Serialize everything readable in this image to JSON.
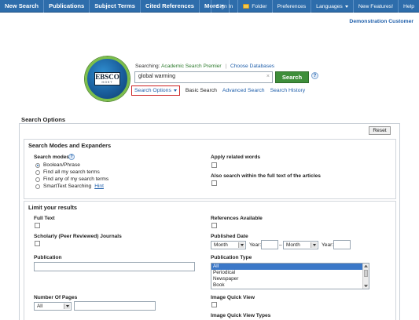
{
  "nav": {
    "left": [
      "New Search",
      "Publications",
      "Subject Terms",
      "Cited References",
      "More"
    ],
    "right": {
      "sign_in": "Sign In",
      "folder": "Folder",
      "preferences": "Preferences",
      "languages": "Languages",
      "new_features": "New Features!",
      "help": "Help"
    }
  },
  "account": {
    "customer": "Demonstration Customer"
  },
  "logo": {
    "main": "EBSCO",
    "sub": "HOST"
  },
  "search": {
    "searching_label": "Searching:",
    "database": "Academic Search Premier",
    "choose_databases": "Choose Databases",
    "query": "global warming",
    "clear": "×",
    "button": "Search",
    "help": "?"
  },
  "sub_options": {
    "search_options": "Search Options",
    "basic": "Basic Search",
    "advanced": "Advanced Search",
    "history": "Search History"
  },
  "options_panel": {
    "title": "Search Options",
    "reset": "Reset",
    "modes": {
      "title": "Search Modes and Expanders",
      "search_modes_label": "Search modes",
      "help": "?",
      "options": [
        "Boolean/Phrase",
        "Find all my search terms",
        "Find any of my search terms",
        "SmartText Searching"
      ],
      "selected_index": 0,
      "hint": "Hint",
      "apply_related": "Apply related words",
      "also_fulltext": "Also search within the full text of the articles"
    },
    "limits": {
      "title": "Limit your results",
      "full_text": "Full Text",
      "references": "References Available",
      "scholarly": "Scholarly (Peer Reviewed) Journals",
      "published_date": "Published Date",
      "month_1": "Month",
      "year_label_1": "Year:",
      "dash": "–",
      "month_2": "Month",
      "year_label_2": "Year:",
      "publication": "Publication",
      "publication_type": "Publication Type",
      "pub_types": [
        "All",
        "Periodical",
        "Newspaper",
        "Book"
      ],
      "pub_type_selected": 0,
      "number_of_pages": "Number Of Pages",
      "pages_select": "All",
      "image_quick_view": "Image Quick View",
      "image_quick_view_types": "Image Quick View Types"
    }
  },
  "colors": {
    "nav_bg": "#2e6dab",
    "search_button": "#3e8e3a",
    "link": "#1e5eaa",
    "highlight_border": "#cc2222",
    "list_selected": "#3b78c8"
  }
}
